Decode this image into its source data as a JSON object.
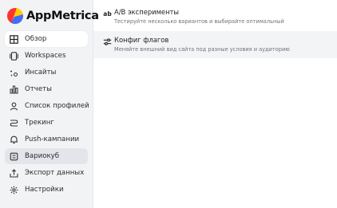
{
  "app": {
    "name": "AppMetrica"
  },
  "sidebar": {
    "items": [
      {
        "label": "Обзор",
        "icon": "grid-icon"
      },
      {
        "label": "Workspaces",
        "icon": "workspaces-icon"
      },
      {
        "label": "Инсайты",
        "icon": "insights-icon"
      },
      {
        "label": "Отчеты",
        "icon": "reports-icon"
      },
      {
        "label": "Список профилей",
        "icon": "profile-icon"
      },
      {
        "label": "Трекинг",
        "icon": "tracking-icon"
      },
      {
        "label": "Push-кампании",
        "icon": "bell-icon"
      },
      {
        "label": "Вариокуб",
        "icon": "variocube-icon"
      },
      {
        "label": "Экспорт данных",
        "icon": "export-icon"
      },
      {
        "label": "Настройки",
        "icon": "gear-icon"
      }
    ]
  },
  "main": {
    "rows": [
      {
        "icon_text": "ab",
        "title": "A/B эксперименты",
        "subtitle": "Тестируйте несколько вариантов и выбирайте оптимальный"
      },
      {
        "title": "Конфиг флагов",
        "subtitle": "Меняйте внешний вид сайта под разные условия и аудиторию"
      }
    ]
  },
  "colors": {
    "sidebar_bg": "#f2f3f5",
    "active_item": "#ffffff",
    "highlight_item": "#e3e5ea",
    "selected_row": "#f3f4f6"
  }
}
